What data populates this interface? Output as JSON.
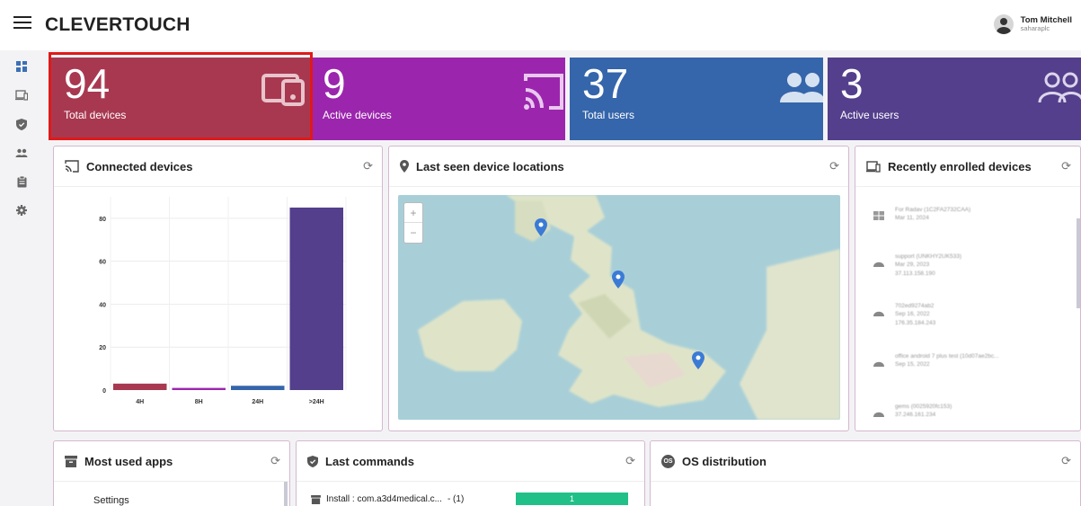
{
  "header": {
    "brand": "CLEVERTOUCH",
    "user_name": "Tom Mitchell",
    "user_org": "saharaplc"
  },
  "sidebar": {
    "icons": [
      "dashboard-icon",
      "devices-icon",
      "shield-icon",
      "users-icon",
      "clipboard-icon",
      "settings-icon"
    ]
  },
  "stats": [
    {
      "value": "94",
      "label": "Total devices",
      "color": "#a83850",
      "icon": "devices-icon"
    },
    {
      "value": "9",
      "label": "Active devices",
      "color": "#9b26ad",
      "icon": "cast-icon"
    },
    {
      "value": "37",
      "label": "Total users",
      "color": "#3565aa",
      "icon": "users-icon"
    },
    {
      "value": "3",
      "label": "Active users",
      "color": "#543f8c",
      "icon": "users-icon"
    }
  ],
  "connected": {
    "title": "Connected devices"
  },
  "chart_data": {
    "type": "bar",
    "categories": [
      "4H",
      "8H",
      "24H",
      ">24H"
    ],
    "values": [
      3,
      1,
      2,
      85
    ],
    "colors": [
      "#a83850",
      "#9b26ad",
      "#3565aa",
      "#543f8c"
    ],
    "ylim": [
      0,
      90
    ],
    "yticks": [
      0,
      20,
      40,
      60,
      80
    ],
    "grid": true
  },
  "locations": {
    "title": "Last seen device locations",
    "zoom_in": "+",
    "zoom_out": "−"
  },
  "enrolled": {
    "title": "Recently enrolled devices",
    "items": [
      {
        "name": "For Radav (1C2FA2732CAA)",
        "date": "Mar 11, 2024",
        "ip": "",
        "icon": "windows-icon"
      },
      {
        "name": "support (UNKHY2UK533)",
        "date": "Mar 29, 2023",
        "ip": "37.113.158.190",
        "icon": "android-icon"
      },
      {
        "name": "702ed9274ab2",
        "date": "Sep 16, 2022",
        "ip": "176.35.184.243",
        "icon": "android-icon"
      },
      {
        "name": "office android 7 plus test (10d07ae2bc...",
        "date": "Sep 15, 2022",
        "ip": "",
        "icon": "android-icon"
      },
      {
        "name": "gems (0025920fc153)",
        "date": "",
        "ip": "37.246.161.234",
        "icon": "android-icon"
      }
    ]
  },
  "apps": {
    "title": "Most used apps",
    "first": "Settings"
  },
  "commands": {
    "title": "Last commands",
    "first_text": "Install : com.a3d4medical.c...",
    "first_count": "- (1)",
    "first_bar": "1"
  },
  "os": {
    "title": "OS distribution",
    "badge": "OS"
  }
}
